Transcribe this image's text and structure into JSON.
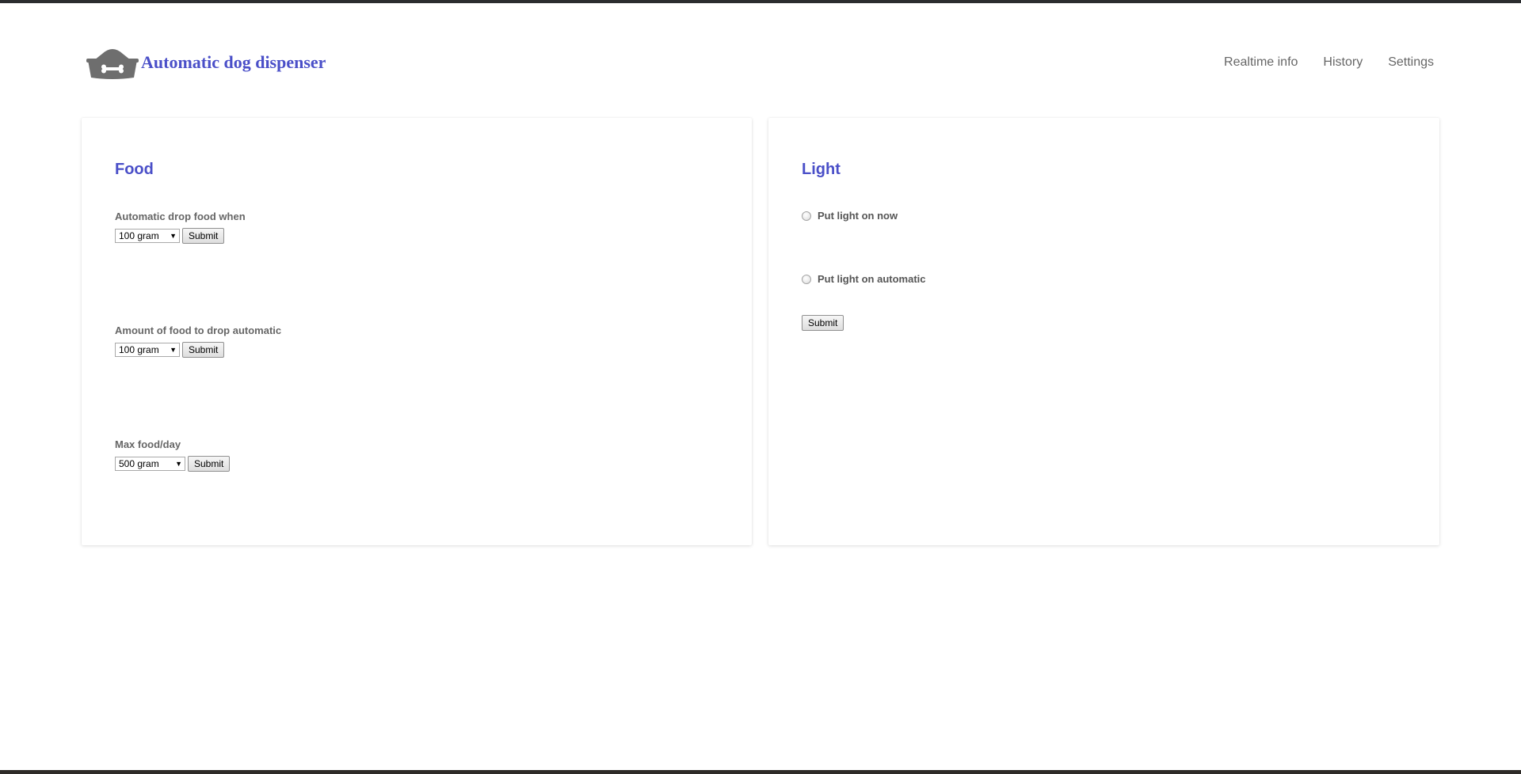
{
  "header": {
    "brand_title": "Automatic dog dispenser",
    "logo_icon": "dog-bowl-bone-icon",
    "nav": [
      {
        "label": "Realtime info"
      },
      {
        "label": "History"
      },
      {
        "label": "Settings"
      }
    ]
  },
  "food": {
    "title": "Food",
    "fields": [
      {
        "label": "Automatic drop food when",
        "selected": "100 gram",
        "submit": "Submit"
      },
      {
        "label": "Amount of food to drop automatic",
        "selected": "100 gram",
        "submit": "Submit"
      },
      {
        "label": "Max food/day",
        "selected": "500 gram",
        "submit": "Submit"
      }
    ]
  },
  "light": {
    "title": "Light",
    "options": [
      {
        "label": "Put light on now",
        "checked": false
      },
      {
        "label": "Put light on automatic",
        "checked": false
      }
    ],
    "submit": "Submit"
  },
  "colors": {
    "accent": "#4a4fc8",
    "nav_text": "#666666",
    "label_text": "#666666"
  }
}
